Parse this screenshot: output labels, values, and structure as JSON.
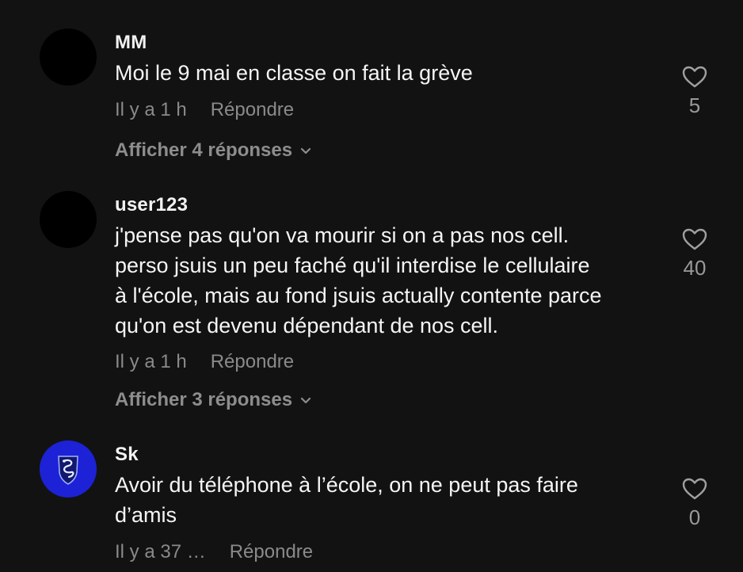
{
  "comments": [
    {
      "username": "MM",
      "text": "Moi le 9 mai en classe on fait la grève",
      "time": "Il y a 1 h",
      "reply_label": "Répondre",
      "view_replies": "Afficher 4 réponses",
      "likes": "5",
      "avatar_color": "#000000"
    },
    {
      "username": "user123",
      "text": "j'pense pas qu'on va mourir si on a pas nos cell.\nperso jsuis un peu faché qu'il interdise le cellulaire\nà l'école, mais au fond jsuis actually contente parce\nqu'on est devenu dépendant de nos cell.",
      "time": "Il y a 1 h",
      "reply_label": "Répondre",
      "view_replies": "Afficher 3 réponses",
      "likes": "40",
      "avatar_color": "#000000"
    },
    {
      "username": "Sk",
      "text": "Avoir du téléphone à l’école, on ne peut pas faire\nd’amis",
      "time": "Il y a 37 …",
      "reply_label": "Répondre",
      "likes": "0",
      "avatar_color": "#1d22d6"
    }
  ],
  "icons": {
    "like": "heart-outline-icon",
    "expand": "chevron-down-icon",
    "avatar_emblem": "snake-crest-icon"
  }
}
